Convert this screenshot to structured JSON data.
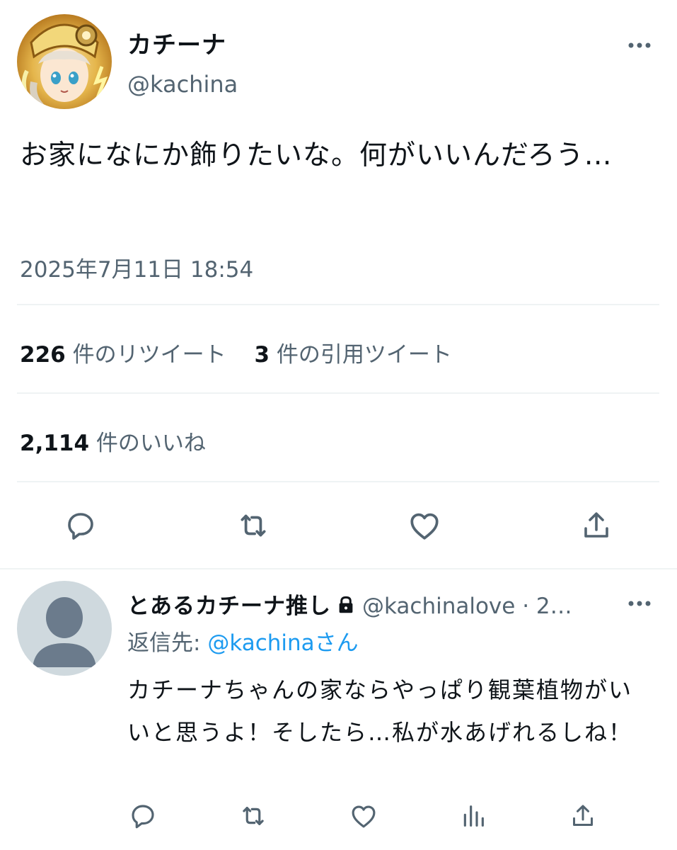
{
  "tweet": {
    "display_name": "カチーナ",
    "handle": "@kachina",
    "text": "お家になにか飾りたいな。何がいいんだろう…",
    "timestamp": "2025年7月11日 18:54",
    "retweets": {
      "count": "226",
      "label": " 件のリツイート"
    },
    "quotes": {
      "count": "3",
      "label": " 件の引用ツイート"
    },
    "likes": {
      "count": "2,114",
      "label": " 件のいいね"
    },
    "actions": [
      "comment-icon",
      "retweet-icon",
      "heart-icon",
      "share-icon"
    ]
  },
  "reply": {
    "display_name": "とあるカチーナ推し",
    "handle_time": "@kachinalove · 2…",
    "replying_prefix": "返信先: ",
    "replying_mention": "@kachinaさん",
    "text": "カチーナちゃんの家ならやっぱり観葉植物がいいと思うよ！そしたら…私が水あげれるしね！",
    "actions": [
      "comment-icon",
      "retweet-icon",
      "heart-icon",
      "analytics-icon",
      "share-icon"
    ]
  },
  "colors": {
    "text": "#0f1419",
    "secondary": "#536471",
    "link": "#1d9bf0",
    "divider": "#eff3f4",
    "avatar_placeholder": "#cfd9de"
  }
}
